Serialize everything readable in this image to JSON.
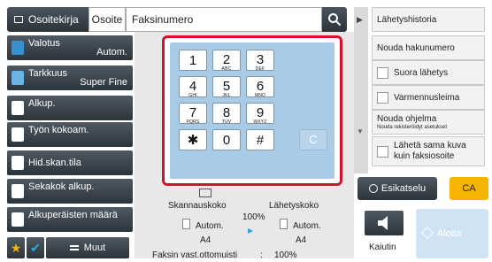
{
  "top": {
    "tab_address_book": "Osoitekirja",
    "tab_address": "Osoite",
    "fax_field": "Faksinumero"
  },
  "left_menu": {
    "exposure_label": "Valotus",
    "exposure_value": "Autom.",
    "resolution_label": "Tarkkuus",
    "resolution_value": "Super Fine",
    "original_label": "Alkup.",
    "job_build_label": "Työn kokoam.",
    "slow_scan_label": "Hid.skan.tila",
    "mixed_original_label": "Sekakok alkup.",
    "original_count_label": "Alkuperäisten määrä",
    "more_label": "Muut"
  },
  "keypad": {
    "keys": [
      {
        "num": "1",
        "sub": ""
      },
      {
        "num": "2",
        "sub": "ABC"
      },
      {
        "num": "3",
        "sub": "DEF"
      },
      {
        "num": "4",
        "sub": "GHI"
      },
      {
        "num": "5",
        "sub": "JKL"
      },
      {
        "num": "6",
        "sub": "MNO"
      },
      {
        "num": "7",
        "sub": "PQRS"
      },
      {
        "num": "8",
        "sub": "TUV"
      },
      {
        "num": "9",
        "sub": "WXYZ"
      },
      {
        "num": "✱",
        "sub": ""
      },
      {
        "num": "0",
        "sub": ""
      },
      {
        "num": "#",
        "sub": ""
      }
    ],
    "clear": "C"
  },
  "info": {
    "scan_size_label": "Skannauskoko",
    "send_size_label": "Lähetyskoko",
    "ratio": "100%",
    "scan_auto": "Autom.",
    "send_auto": "Autom.",
    "scan_paper": "A4",
    "send_paper": "A4",
    "memory_label": "Faksin vast.ottomuisti",
    "memory_colon": ":",
    "memory_value": "100%"
  },
  "right_menu": {
    "send_history": "Lähetyshistoria",
    "recall_search": "Nouda hakunumero",
    "direct_send": "Suora lähetys",
    "verification_stamp": "Varmennusleima",
    "recall_program": "Nouda ohjelma",
    "recall_program_sub": "Nouda rekisteröidyt asetukset",
    "send_same_image_line1": "Lähetä sama kuva",
    "send_same_image_line2": "kuin faksiosoite"
  },
  "actions": {
    "preview": "Esikatselu",
    "ca": "CA",
    "speaker": "Kaiutin",
    "start": "Aloita"
  },
  "colors": {
    "accent_red": "#d2122e",
    "keypad_blue": "#a9cbe6",
    "ca_yellow": "#f5b400",
    "dark_button": "#2c343b"
  }
}
